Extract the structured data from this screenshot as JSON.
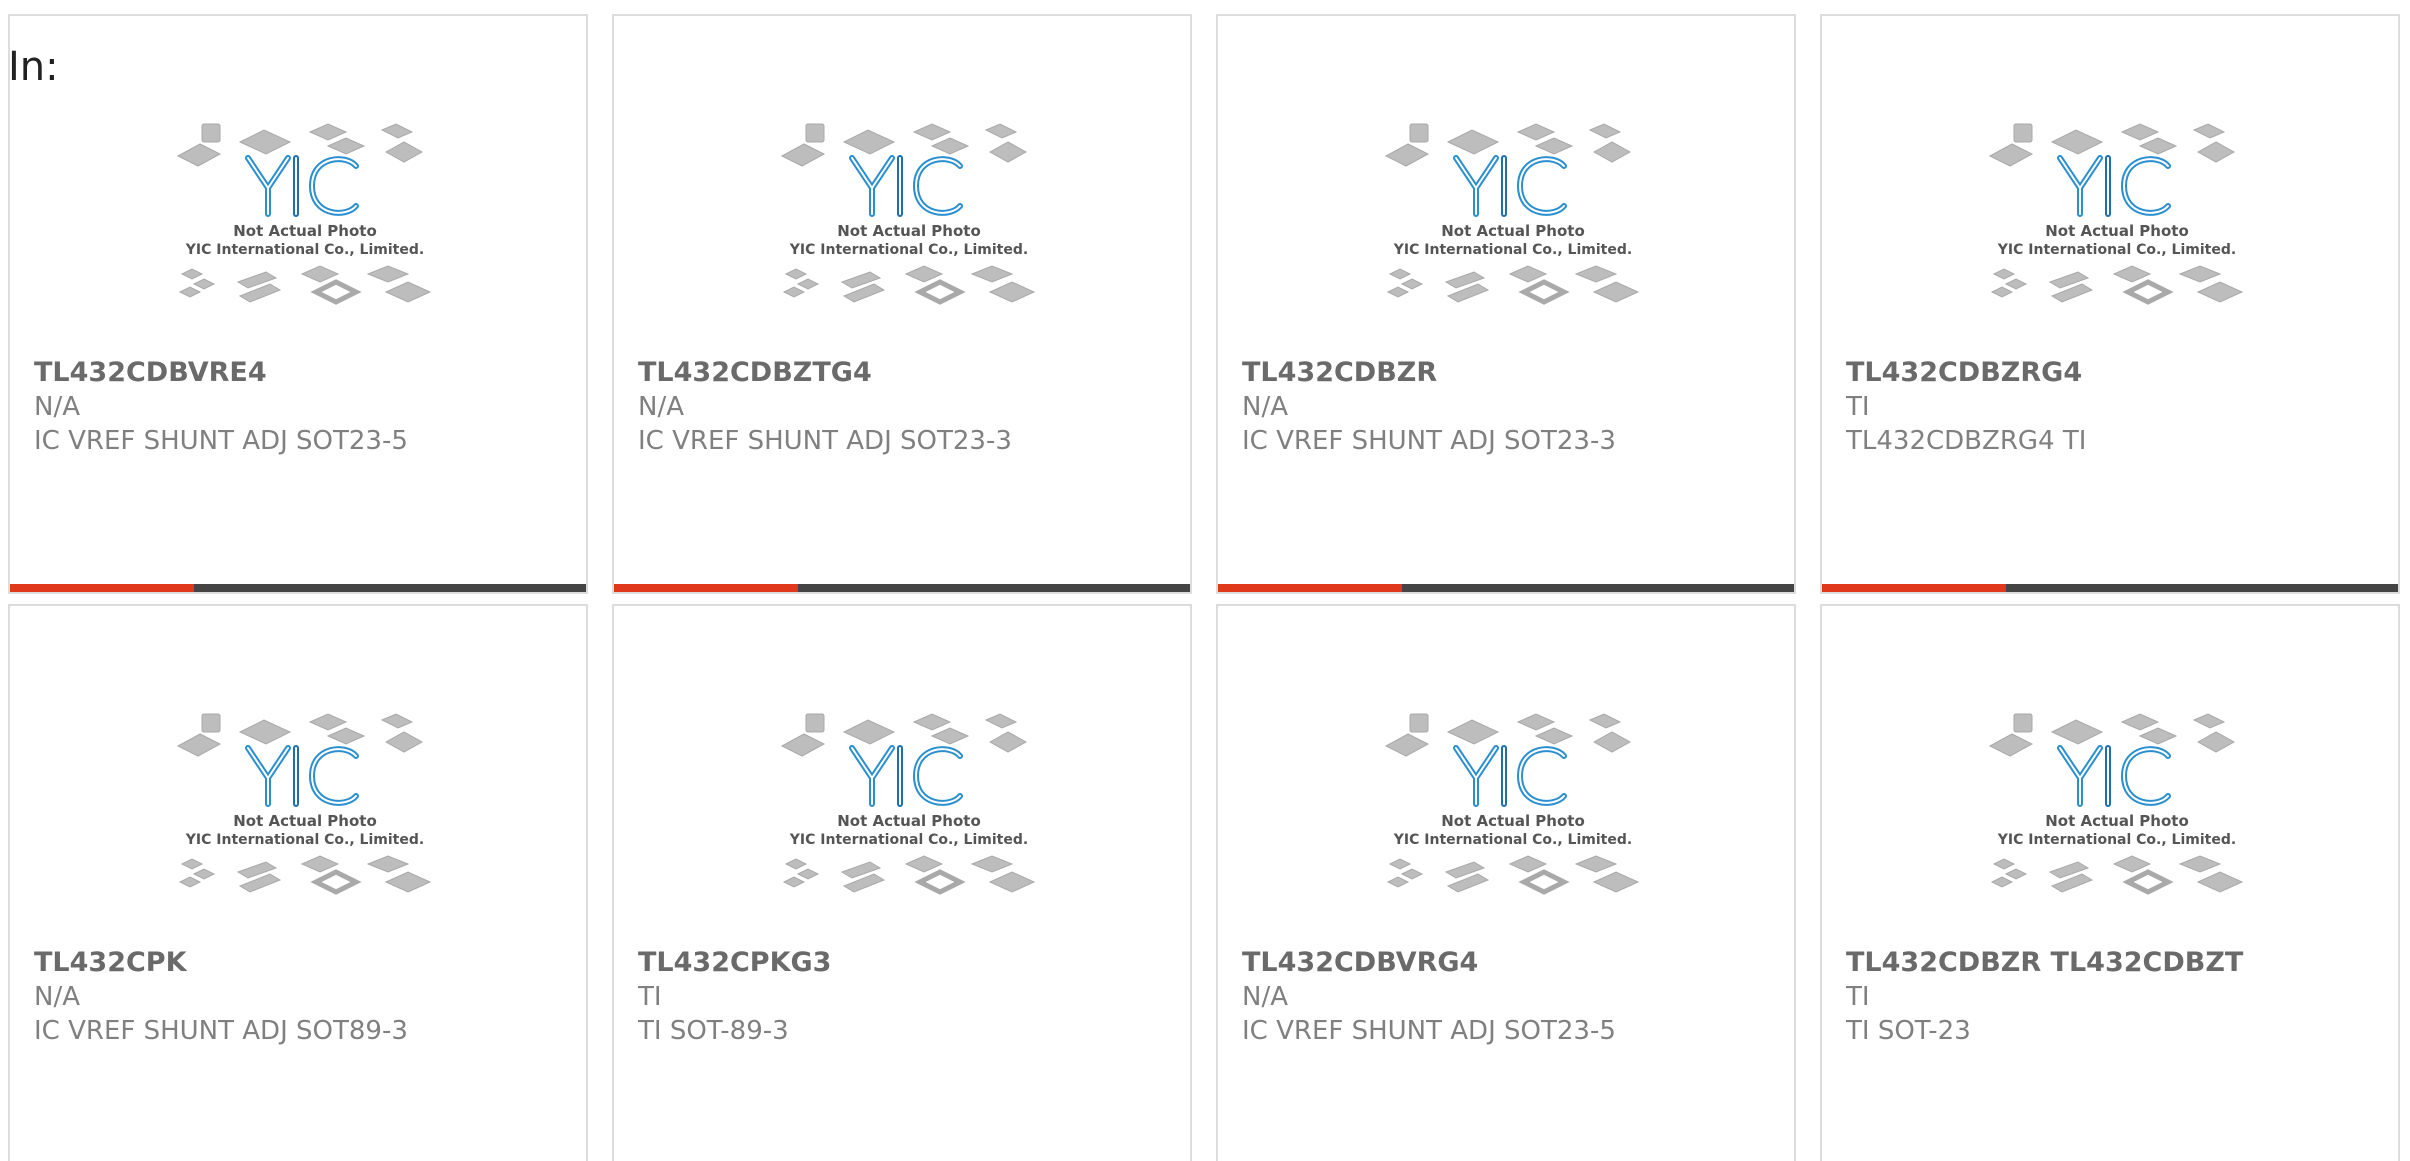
{
  "header": {
    "label": "In:"
  },
  "colors": {
    "accent": "#e0381a",
    "track": "#444444",
    "logo_blue": "#2a8fd0",
    "chip_gray": "#b9b9b9"
  },
  "placeholder": {
    "line1": "Not Actual Photo",
    "line2": "YIC International Co., Limited.",
    "logo_text": "YIC"
  },
  "products": [
    {
      "part": "TL432CDBVRE4",
      "manufacturer": "N/A",
      "description": "IC VREF SHUNT ADJ SOT23-5",
      "progress": 0.32,
      "show_progress": true
    },
    {
      "part": "TL432CDBZTG4",
      "manufacturer": "N/A",
      "description": "IC VREF SHUNT ADJ SOT23-3",
      "progress": 0.32,
      "show_progress": true
    },
    {
      "part": "TL432CDBZR",
      "manufacturer": "N/A",
      "description": "IC VREF SHUNT ADJ SOT23-3",
      "progress": 0.32,
      "show_progress": true
    },
    {
      "part": "TL432CDBZRG4",
      "manufacturer": "TI",
      "description": "TL432CDBZRG4 TI",
      "progress": 0.32,
      "show_progress": true
    },
    {
      "part": "TL432CPK",
      "manufacturer": "N/A",
      "description": "IC VREF SHUNT ADJ SOT89-3",
      "progress": 0.0,
      "show_progress": false
    },
    {
      "part": "TL432CPKG3",
      "manufacturer": "TI",
      "description": "TI SOT-89-3",
      "progress": 0.0,
      "show_progress": false
    },
    {
      "part": "TL432CDBVRG4",
      "manufacturer": "N/A",
      "description": "IC VREF SHUNT ADJ SOT23-5",
      "progress": 0.0,
      "show_progress": false
    },
    {
      "part": "TL432CDBZR TL432CDBZT",
      "manufacturer": "TI",
      "description": "TI SOT-23",
      "progress": 0.0,
      "show_progress": false
    }
  ]
}
